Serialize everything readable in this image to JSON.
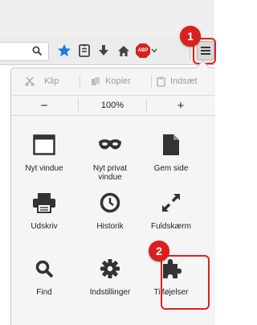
{
  "toolbar": {
    "icons": [
      "search-icon",
      "bookmark-star-icon",
      "reading-list-icon",
      "download-arrow-icon",
      "home-icon",
      "adblock-abp-icon",
      "chevron-down-icon",
      "hamburger-menu-icon"
    ],
    "adblock_label": "ABP",
    "star_color": "#1a7ae6",
    "adblock_color": "#d32420"
  },
  "annotations": {
    "step1": "1",
    "step2": "2",
    "color": "#e0201d"
  },
  "menu": {
    "edit": {
      "cut": "Klip",
      "copy": "Kopier",
      "paste": "Indsæt"
    },
    "zoom": {
      "minus": "−",
      "level": "100%",
      "plus": "+"
    },
    "items": [
      {
        "label": "Nyt vindue",
        "icon": "window-icon"
      },
      {
        "label": "Nyt privat vindue",
        "icon": "private-mask-icon"
      },
      {
        "label": "Gem side",
        "icon": "save-page-icon"
      },
      {
        "label": "Udskriv",
        "icon": "printer-icon"
      },
      {
        "label": "Historik",
        "icon": "history-clock-icon"
      },
      {
        "label": "Fuldskærm",
        "icon": "fullscreen-arrows-icon"
      },
      {
        "label": "Find",
        "icon": "magnifier-icon"
      },
      {
        "label": "Indstillinger",
        "icon": "gear-icon"
      },
      {
        "label": "Tilføjelser",
        "icon": "puzzle-piece-icon"
      }
    ]
  }
}
